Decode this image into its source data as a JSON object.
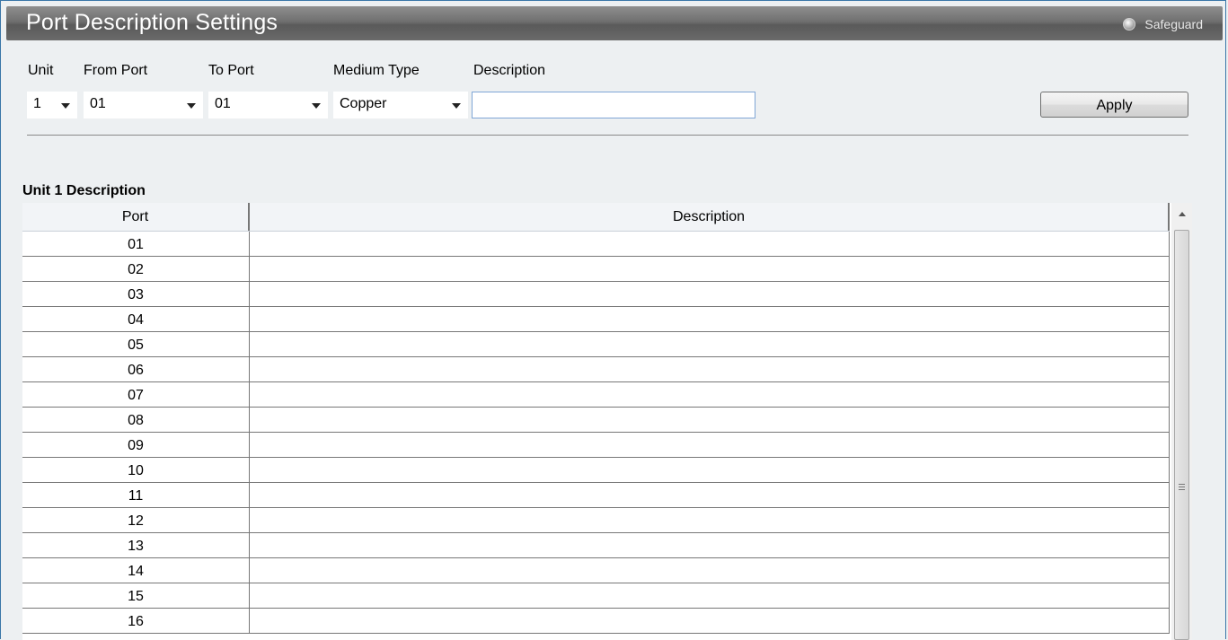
{
  "header": {
    "title": "Port Description Settings",
    "safeguard_label": "Safeguard"
  },
  "form": {
    "labels": {
      "unit": "Unit",
      "from_port": "From Port",
      "to_port": "To Port",
      "medium_type": "Medium Type",
      "description": "Description"
    },
    "unit_value": "1",
    "from_port_value": "01",
    "to_port_value": "01",
    "medium_type_value": "Copper",
    "description_value": "",
    "apply_label": "Apply"
  },
  "table": {
    "section_title": "Unit 1 Description",
    "columns": [
      "Port",
      "Description"
    ],
    "rows": [
      {
        "port": "01",
        "description": ""
      },
      {
        "port": "02",
        "description": ""
      },
      {
        "port": "03",
        "description": ""
      },
      {
        "port": "04",
        "description": ""
      },
      {
        "port": "05",
        "description": ""
      },
      {
        "port": "06",
        "description": ""
      },
      {
        "port": "07",
        "description": ""
      },
      {
        "port": "08",
        "description": ""
      },
      {
        "port": "09",
        "description": ""
      },
      {
        "port": "10",
        "description": ""
      },
      {
        "port": "11",
        "description": ""
      },
      {
        "port": "12",
        "description": ""
      },
      {
        "port": "13",
        "description": ""
      },
      {
        "port": "14",
        "description": ""
      },
      {
        "port": "15",
        "description": ""
      },
      {
        "port": "16",
        "description": ""
      }
    ]
  },
  "colors": {
    "background": "#edf0f2",
    "title_bar": "#6a6a6a",
    "frame_border": "#3a76a8",
    "input_border": "#7fa6d6"
  },
  "icons": {
    "safeguard": "radio-circle-icon",
    "select_arrow": "caret-down-icon",
    "scroll_up": "scroll-up-arrow-icon"
  }
}
